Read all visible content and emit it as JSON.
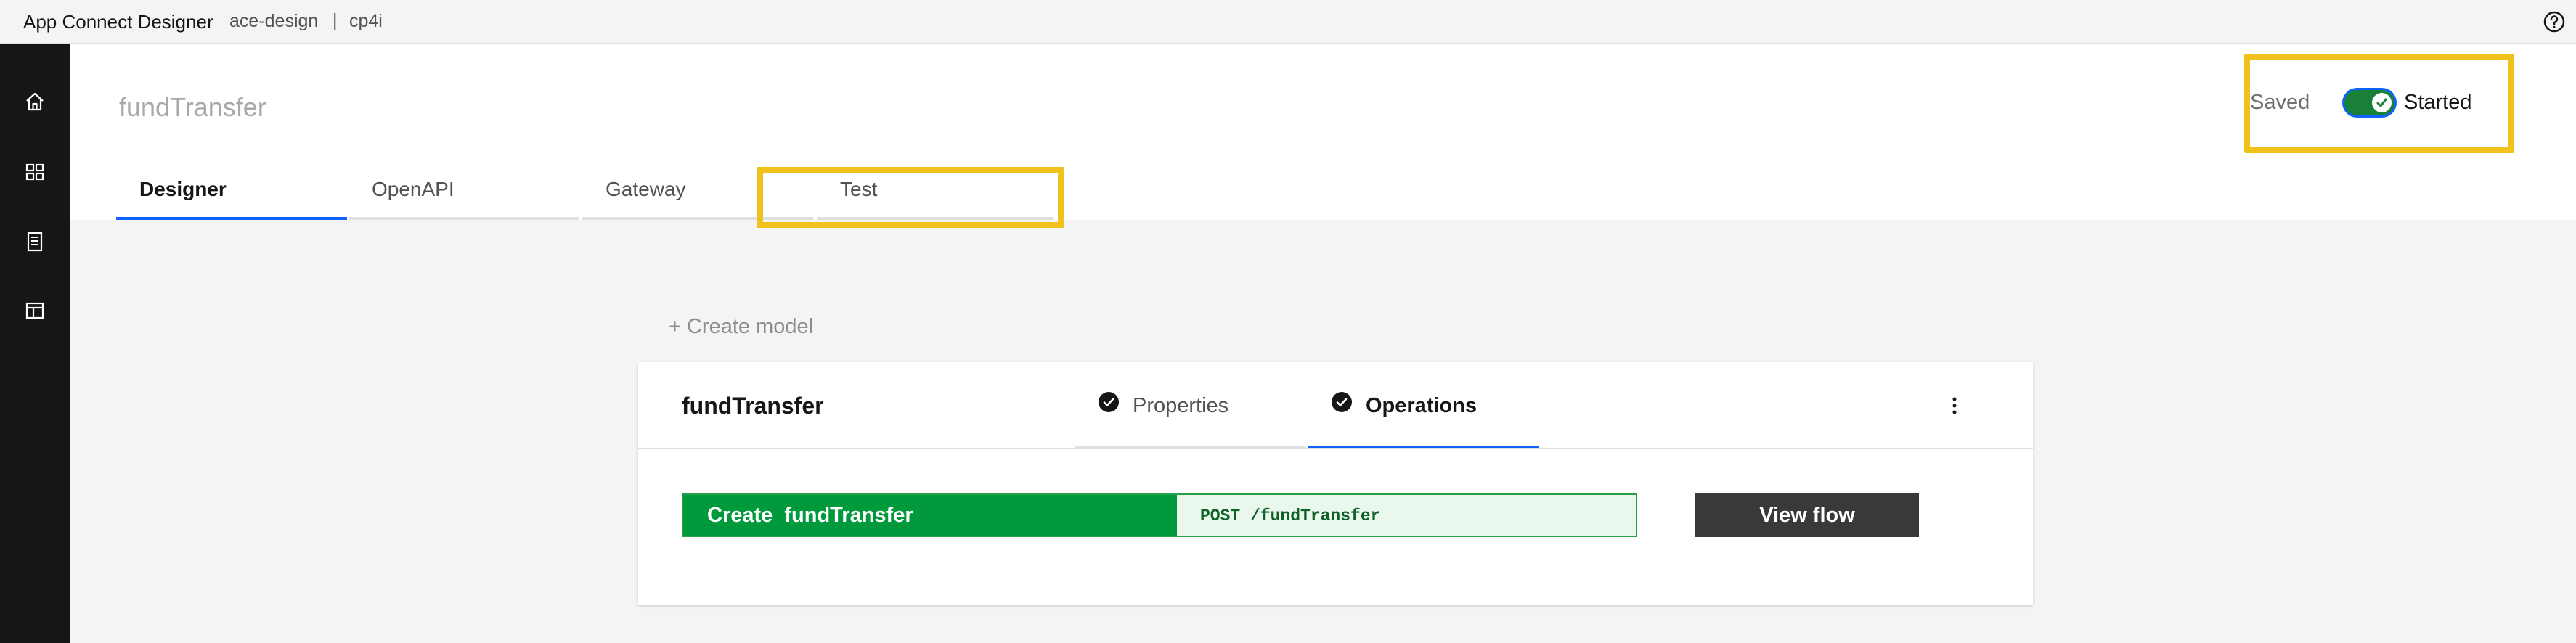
{
  "header": {
    "app_name": "App Connect Designer",
    "breadcrumb": [
      "ace-design",
      "cp4i"
    ],
    "breadcrumb_separator": "|",
    "help_icon": "help-icon"
  },
  "sidebar": {
    "items": [
      {
        "icon": "home-icon"
      },
      {
        "icon": "dashboard-icon"
      },
      {
        "icon": "catalog-icon"
      },
      {
        "icon": "template-icon"
      }
    ]
  },
  "page": {
    "title": "fundTransfer",
    "save_status": "Saved",
    "run_status": "Started",
    "toggle_on": true,
    "settings_icon": "settings-icon",
    "tabs": [
      {
        "label": "Designer",
        "active": true
      },
      {
        "label": "OpenAPI",
        "active": false
      },
      {
        "label": "Gateway",
        "active": false
      },
      {
        "label": "Test",
        "active": false
      }
    ]
  },
  "model": {
    "create_label": "+ Create model",
    "name": "fundTransfer",
    "tabs": [
      {
        "label": "Properties",
        "complete": true,
        "active": false
      },
      {
        "label": "Operations",
        "complete": true,
        "active": true
      }
    ],
    "overflow_icon": "overflow-menu-icon",
    "operation": {
      "verb_label": "Create  fundTransfer",
      "method_path": "POST /fundTransfer"
    },
    "view_flow_label": "View flow"
  },
  "colors": {
    "highlight": "#f1c21b",
    "primary": "#0f62fe",
    "success": "#198038",
    "operation_green": "#00993b",
    "rail": "#161616"
  }
}
